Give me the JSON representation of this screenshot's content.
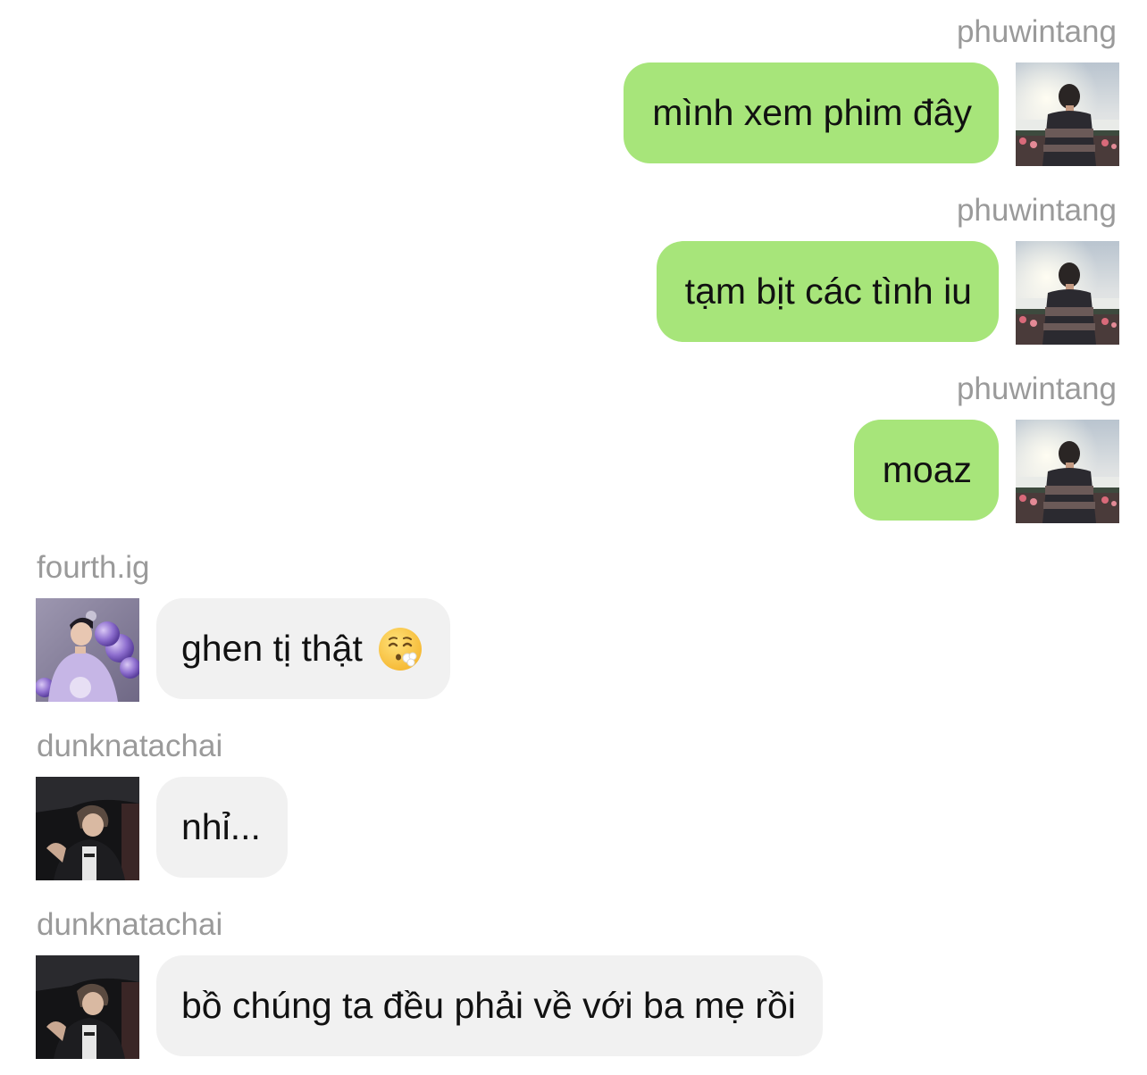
{
  "messages": [
    {
      "user": "phuwintang",
      "text": "mình xem phim đây",
      "direction": "outgoing",
      "avatar": "phuwintang-avatar"
    },
    {
      "user": "phuwintang",
      "text": "tạm bịt các tình iu",
      "direction": "outgoing",
      "avatar": "phuwintang-avatar"
    },
    {
      "user": "phuwintang",
      "text": "moaz",
      "direction": "outgoing",
      "avatar": "phuwintang-avatar"
    },
    {
      "user": "fourth.ig",
      "text": "ghen tị thật",
      "emoji": "face-exhaling-emoji",
      "direction": "incoming",
      "avatar": "fourth-avatar"
    },
    {
      "user": "dunknatachai",
      "text": "nhỉ...",
      "direction": "incoming",
      "avatar": "dunk-avatar"
    },
    {
      "user": "dunknatachai",
      "text": "bồ chúng ta đều phải về với ba mẹ rồi",
      "direction": "incoming",
      "avatar": "dunk-avatar"
    }
  ],
  "colors": {
    "outgoing_bubble": "#a7e57a",
    "incoming_bubble": "#f1f1f1",
    "username": "#9a9a9a",
    "text": "#111111"
  }
}
